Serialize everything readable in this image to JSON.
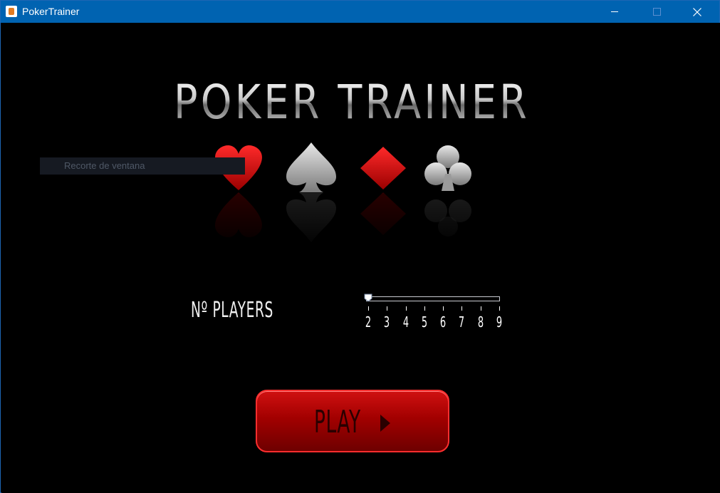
{
  "window": {
    "title": "PokerTrainer",
    "titlebar_color": "#0063b1"
  },
  "logo": {
    "text": "POKER TRAINER"
  },
  "tooltip": {
    "text": "Recorte de ventana"
  },
  "suits": [
    "heart-icon",
    "spade-icon",
    "diamond-icon",
    "club-icon"
  ],
  "players": {
    "label": "Nº PLAYERS",
    "min": 2,
    "max": 9,
    "value": 2,
    "ticks": [
      "2",
      "3",
      "4",
      "5",
      "6",
      "7",
      "8",
      "9"
    ]
  },
  "play_button": {
    "label": "PLAY",
    "color": "#b00000"
  }
}
